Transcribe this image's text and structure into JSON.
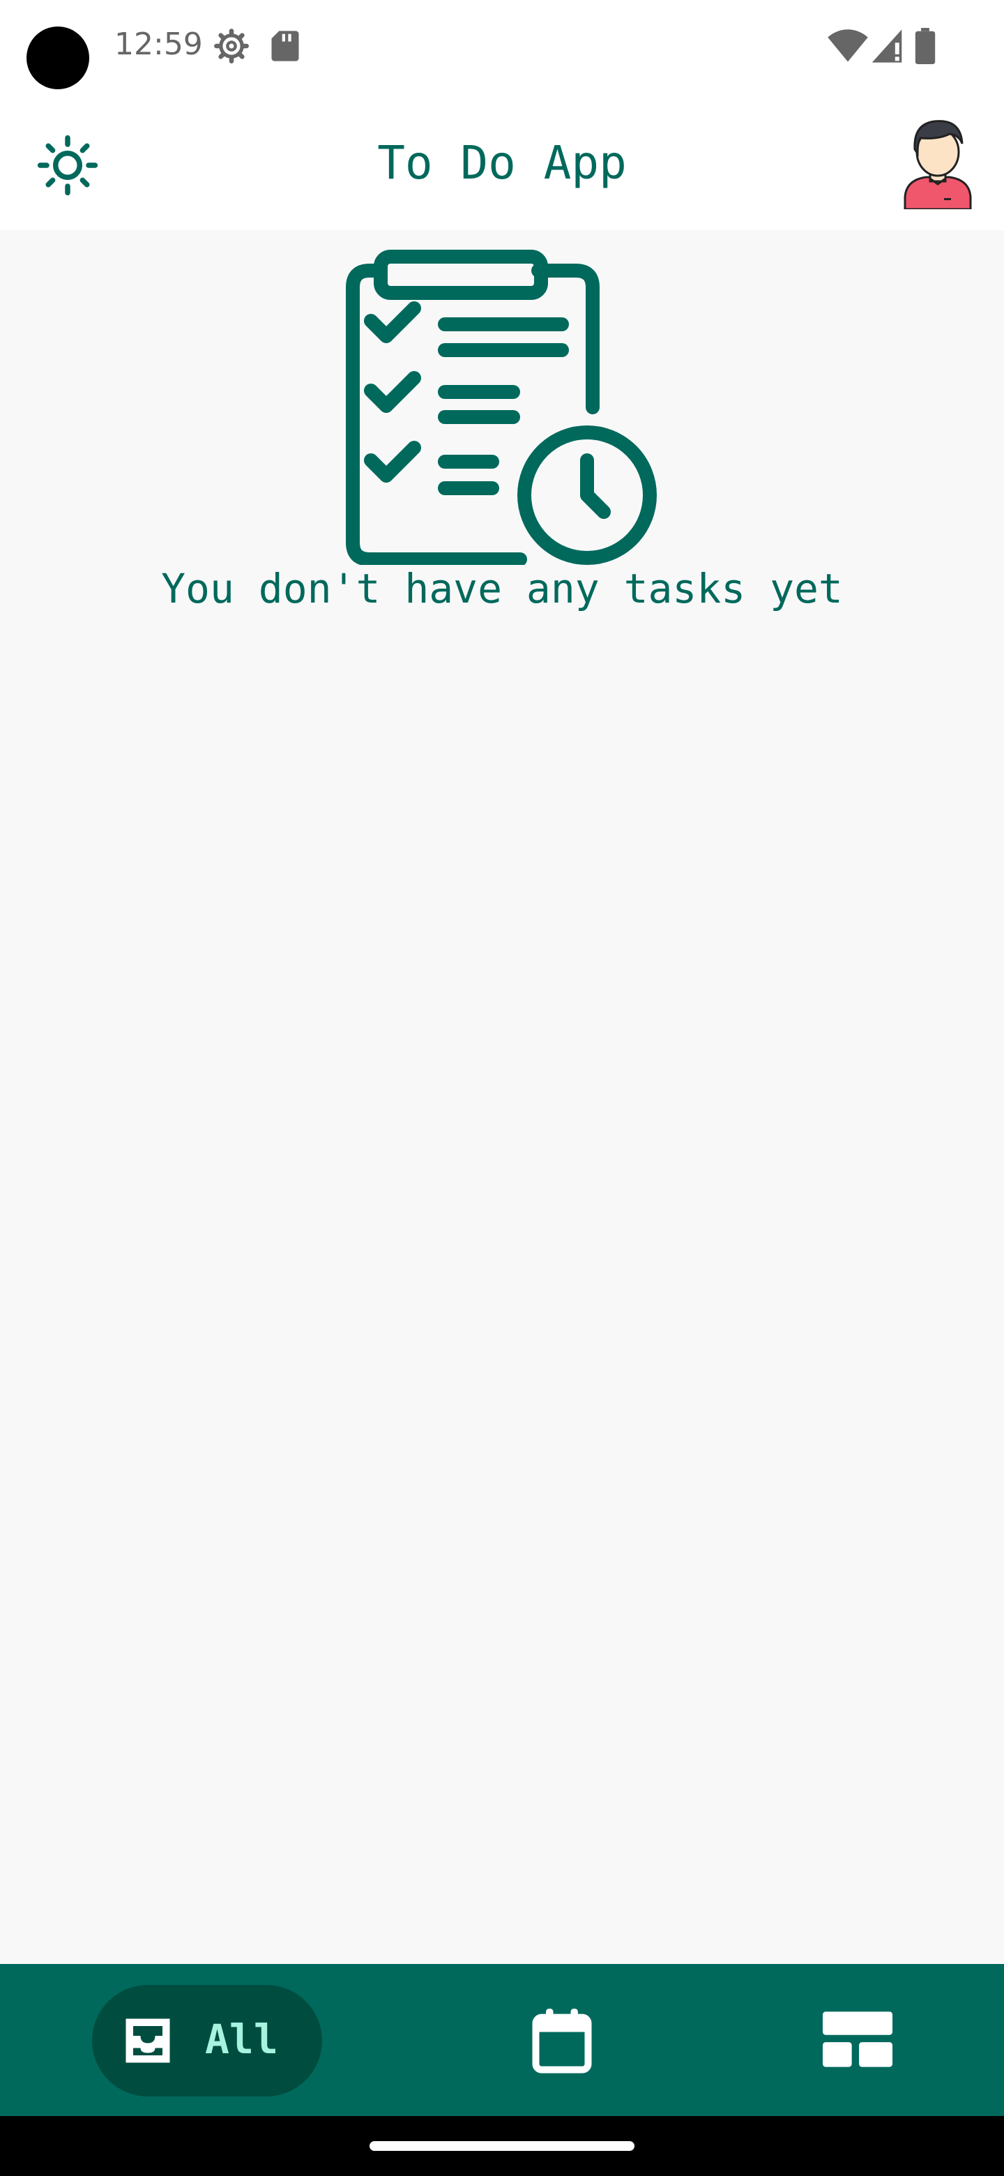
{
  "status_bar": {
    "time": "12:59",
    "icons": [
      "settings-gear-icon",
      "sd-card-icon",
      "wifi-icon",
      "cellular-signal-icon",
      "battery-icon"
    ]
  },
  "header": {
    "title": "To Do App",
    "left_icon": "sun-theme-icon",
    "right_icon": "user-avatar"
  },
  "empty_state": {
    "icon": "clipboard-checklist-clock-icon",
    "message": "You don't have any tasks yet"
  },
  "bottom_nav": {
    "items": [
      {
        "label": "All",
        "icon": "inbox-tray-icon",
        "selected": true
      },
      {
        "label": "",
        "icon": "calendar-icon",
        "selected": false
      },
      {
        "label": "",
        "icon": "board-layout-icon",
        "selected": false
      }
    ]
  },
  "colors": {
    "primary": "#00695c",
    "nav_selected_bg": "#004d40",
    "nav_selected_text": "#a7f3df",
    "background": "#f8f8f8"
  }
}
